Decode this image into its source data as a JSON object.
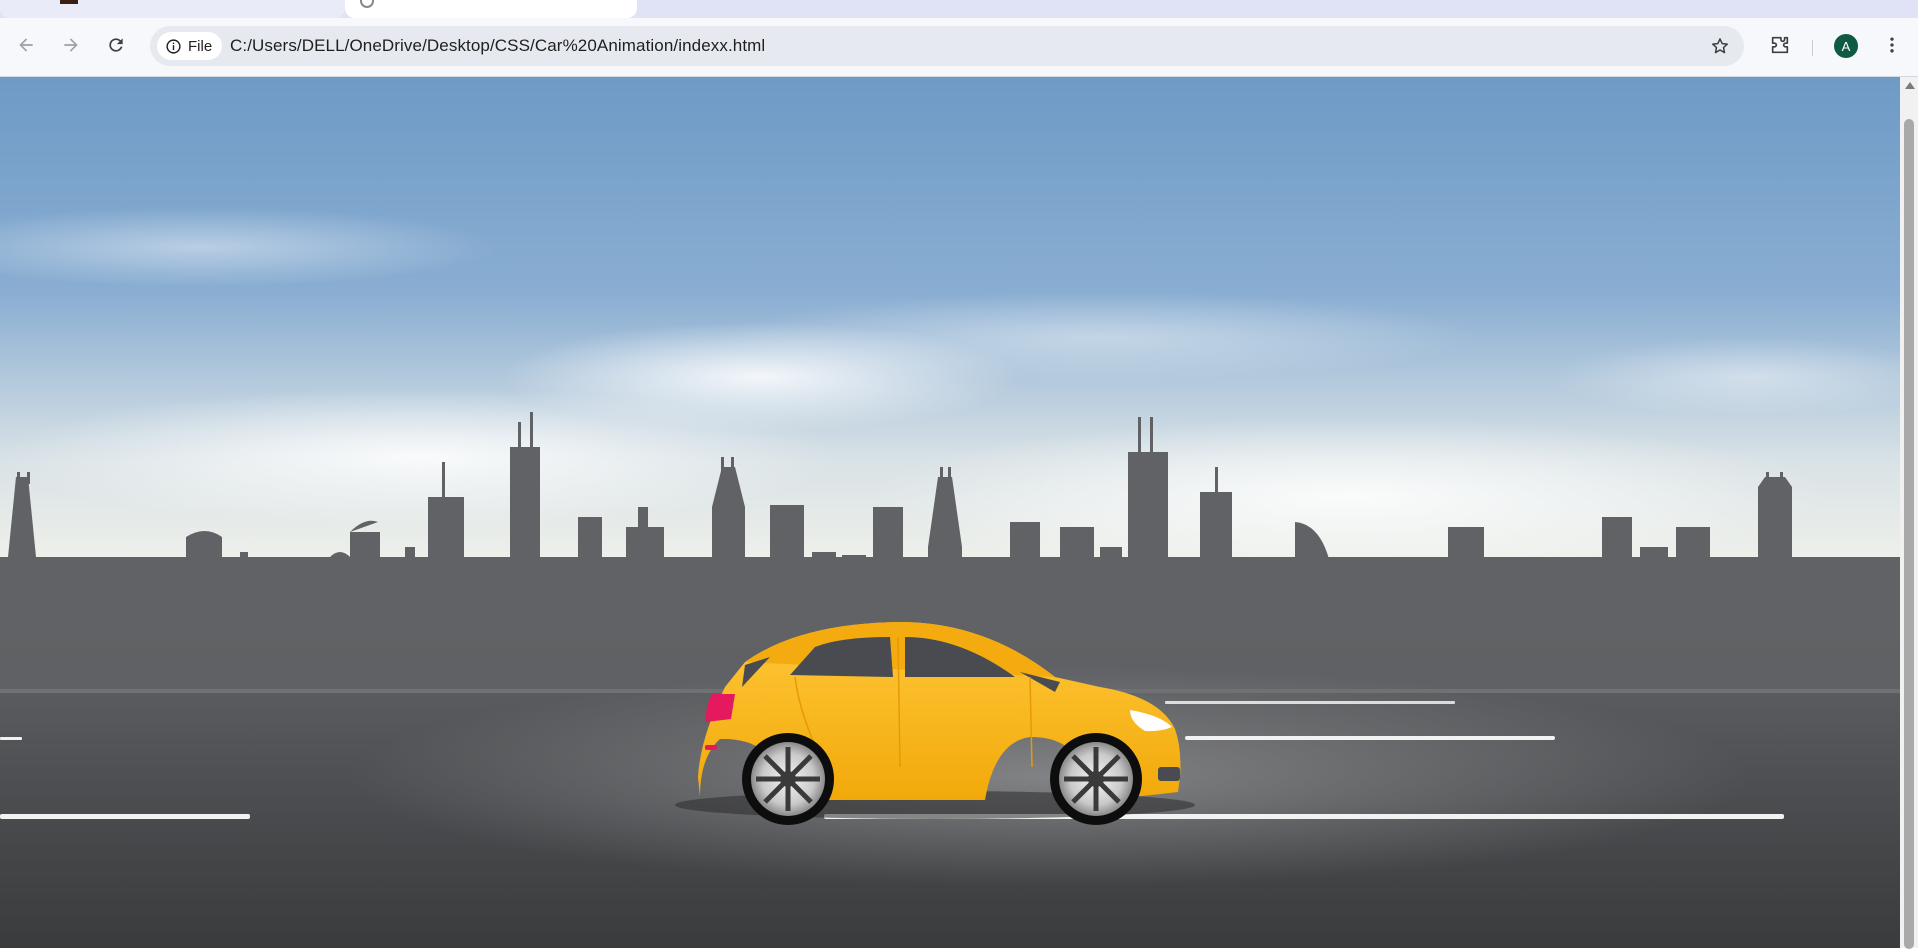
{
  "browser": {
    "url": "C:/Users/DELL/OneDrive/Desktop/CSS/Car%20Animation/indexx.html",
    "chip_label": "File",
    "avatar_initial": "A",
    "avatar_color": "#0f5a43"
  },
  "scene": {
    "sky_colors": [
      "#6f9cc9",
      "#e9eef0"
    ],
    "skyline_color": "#5c5d60",
    "road_color": "#4a4b4d",
    "car_color": "#ffbd14",
    "lane_color": "#f2f2f2"
  },
  "icons": [
    "back-arrow-icon",
    "forward-arrow-icon",
    "reload-icon",
    "info-icon",
    "star-icon",
    "extensions-icon",
    "kebab-menu-icon"
  ]
}
